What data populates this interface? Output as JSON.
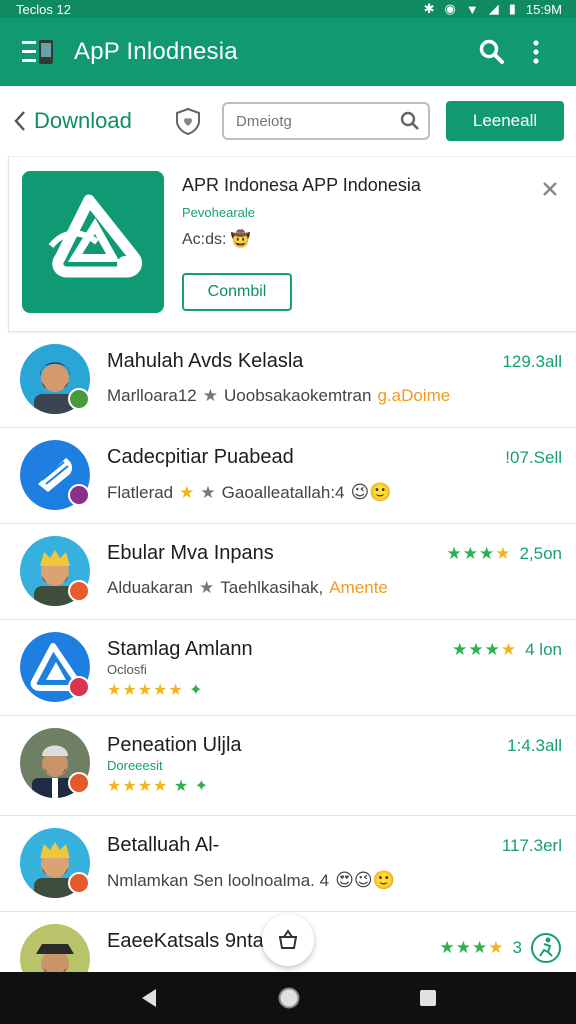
{
  "status": {
    "left": "Teclos 12",
    "right": "15:9M"
  },
  "appbar": {
    "title": "ApP Inlodnesia",
    "menu_icon": "menu-icon",
    "search_icon": "search-icon",
    "more_icon": "more-vert-icon"
  },
  "toolbar": {
    "back_label": "Download",
    "fav_icon": "heart-shield-icon",
    "search_placeholder": "Dmeiotg",
    "cta_label": "Leeneall"
  },
  "card": {
    "name": "APR Indonesa APP Indonesia",
    "developer": "Pevohearale",
    "ads_label": "Ac:ds: 🤠",
    "install_label": "Conmbil",
    "accent": "#119a6f"
  },
  "rows": [
    {
      "title": "Mahulah Avds Kelasla",
      "sub": "Marlloara12",
      "sub2": "Uoobsakaokemtran",
      "sub_accent": "g.aDoime",
      "size": "129.3all",
      "badge_color": "#4b9a3a"
    },
    {
      "title": "Cadecpitiar Puabead",
      "sub": "Flatlerad",
      "sub2": "Gaoalleatallah:4",
      "emoji": "😉🙂",
      "size": "!07.Sell",
      "badge_color": "#8b2f8c"
    },
    {
      "title": "Ebular Mva Inpans",
      "sub": "Alduakaran",
      "sub2": "Taehlkasihak,",
      "sub_accent": "Amente",
      "size": "2,5on",
      "stars": "3.5",
      "badge_color": "#e75b2c"
    },
    {
      "title": "Stamlag Amlann",
      "small": "Oclosfi",
      "size": "4 lon",
      "stars": "3.5",
      "rating_row": "★★★★★",
      "badge_color": "#d9364b"
    },
    {
      "title": "Peneation Uljla",
      "small": "Doreeesit",
      "size": "1:4.3all",
      "rating_row": "★★★★",
      "badge_color": "#e25a2b"
    },
    {
      "title": "Betalluah Al-",
      "sub": "Nmlamkan Sen loolnoalma. 4",
      "emoji": "😍😉🙂",
      "size": "117.3erl",
      "badge_color": "#e45a2a"
    },
    {
      "title": "EaeeKatsals 9ntal",
      "size": "3",
      "stars": "3.5",
      "badge_color": "#e25a2b"
    }
  ],
  "fab_icon": "basket-icon",
  "nav": {
    "back": "back-triangle-icon",
    "home": "home-circle-icon",
    "recents": "recents-square-icon"
  }
}
